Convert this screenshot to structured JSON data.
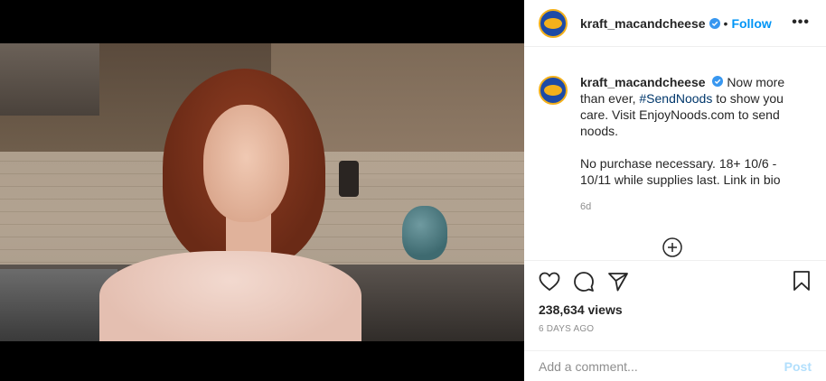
{
  "post": {
    "username": "kraft_macandcheese",
    "follow_separator": "•",
    "follow_label": "Follow",
    "more_label": "•••",
    "caption": {
      "line1_rest": "Now more than ever,",
      "hashtag": "#SendNoods",
      "line1_end": "to show you care. Visit EnjoyNoods.com to send noods.",
      "line2": "No purchase necessary. 18+ 10/6 - 10/11 while supplies last. Link in bio",
      "time": "6d"
    },
    "views": "238,634 views",
    "ago": "6 DAYS AGO",
    "comment": {
      "placeholder": "Add a comment...",
      "post_label": "Post"
    }
  },
  "colors": {
    "link": "#0095f6",
    "hashtag": "#00376b",
    "muted": "#8e8e8e",
    "post_disabled": "#b2dffc"
  },
  "icons": [
    "verified-badge-icon",
    "more-icon",
    "add-circle-icon",
    "heart-icon",
    "comment-icon",
    "share-icon",
    "bookmark-icon",
    "sound-icon"
  ]
}
